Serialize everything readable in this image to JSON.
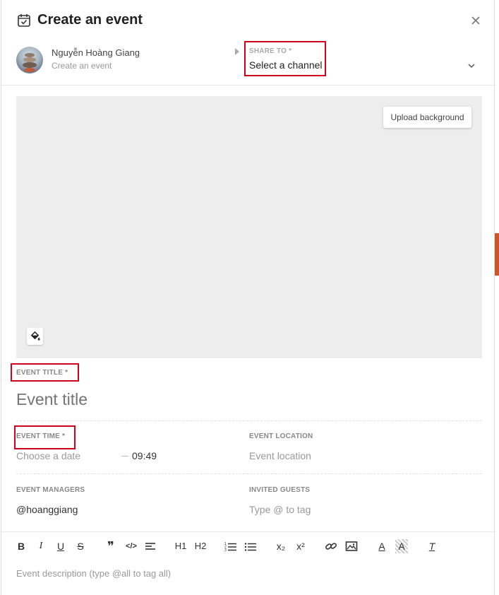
{
  "header": {
    "title": "Create an event",
    "icon": "calendar-check-icon",
    "close_icon": "close-icon"
  },
  "author": {
    "name": "Nguyễn Hoàng Giang",
    "subtitle": "Create an event"
  },
  "share": {
    "label": "SHARE TO *",
    "selected": "Select a channel"
  },
  "cover": {
    "upload_label": "Upload background",
    "paint_icon": "paint-bucket-icon",
    "background_color": "#ededed"
  },
  "event_title": {
    "label": "EVENT TITLE *",
    "placeholder": "Event title"
  },
  "event_time": {
    "label": "EVENT TIME *",
    "date_placeholder": "Choose a date",
    "time_value": "09:49"
  },
  "event_location": {
    "label": "EVENT LOCATION",
    "placeholder": "Event location"
  },
  "event_managers": {
    "label": "EVENT MANAGERS",
    "value": "@hoanggiang"
  },
  "invited_guests": {
    "label": "INVITED GUESTS",
    "placeholder": "Type @ to tag"
  },
  "toolbar": {
    "bold": "B",
    "italic": "I",
    "underline": "U",
    "strike": "S",
    "quote": "❞",
    "code": "</>",
    "align": "align-icon",
    "h1": "H1",
    "h2": "H2",
    "ordered_list": "ordered-list-icon",
    "bullet_list": "bullet-list-icon",
    "subscript": "x₂",
    "superscript": "x²",
    "link": "link-icon",
    "image": "image-icon",
    "text_color": "A",
    "highlight": "A",
    "clear_format": "T"
  },
  "description": {
    "placeholder": "Event description (type @all to tag all)"
  },
  "colors": {
    "highlight_box": "#d0021b",
    "accent_text": "#222222"
  }
}
